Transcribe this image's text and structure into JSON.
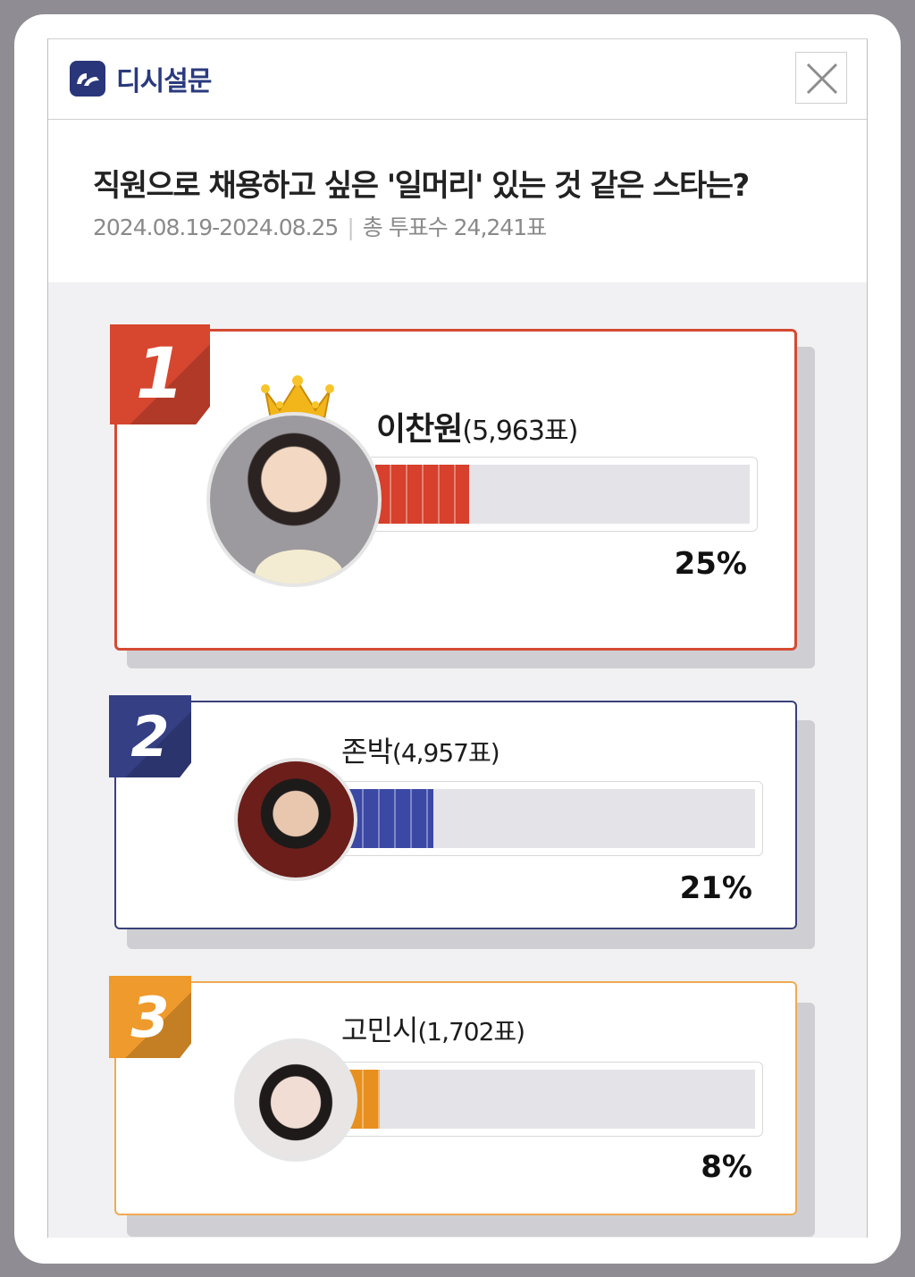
{
  "header": {
    "brand": "디시설문",
    "logo_icon": "dc-logo-icon",
    "close_icon": "close-icon"
  },
  "poll": {
    "title": "직원으로 채용하고 싶은 '일머리' 있는 것 같은 스타는?",
    "period": "2024.08.19-2024.08.25",
    "separator": "|",
    "total_votes": "총 투표수 24,241표"
  },
  "results": [
    {
      "rank": "1",
      "name": "이찬원",
      "votes": "(5,963표)",
      "percent_text": "25%",
      "percent": 25,
      "color": "#d6402c",
      "border": "#d44a33",
      "badge_color": "#d7462f",
      "crown_icon": "crown-icon"
    },
    {
      "rank": "2",
      "name": "존박",
      "votes": "(4,957표)",
      "percent_text": "21%",
      "percent": 21,
      "color": "#3b48a4",
      "border": "#38407a",
      "badge_color": "#343f84"
    },
    {
      "rank": "3",
      "name": "고민시",
      "votes": "(1,702표)",
      "percent_text": "8%",
      "percent": 8,
      "color": "#e8901f",
      "border": "#efab52",
      "badge_color": "#ef9a2c"
    }
  ]
}
